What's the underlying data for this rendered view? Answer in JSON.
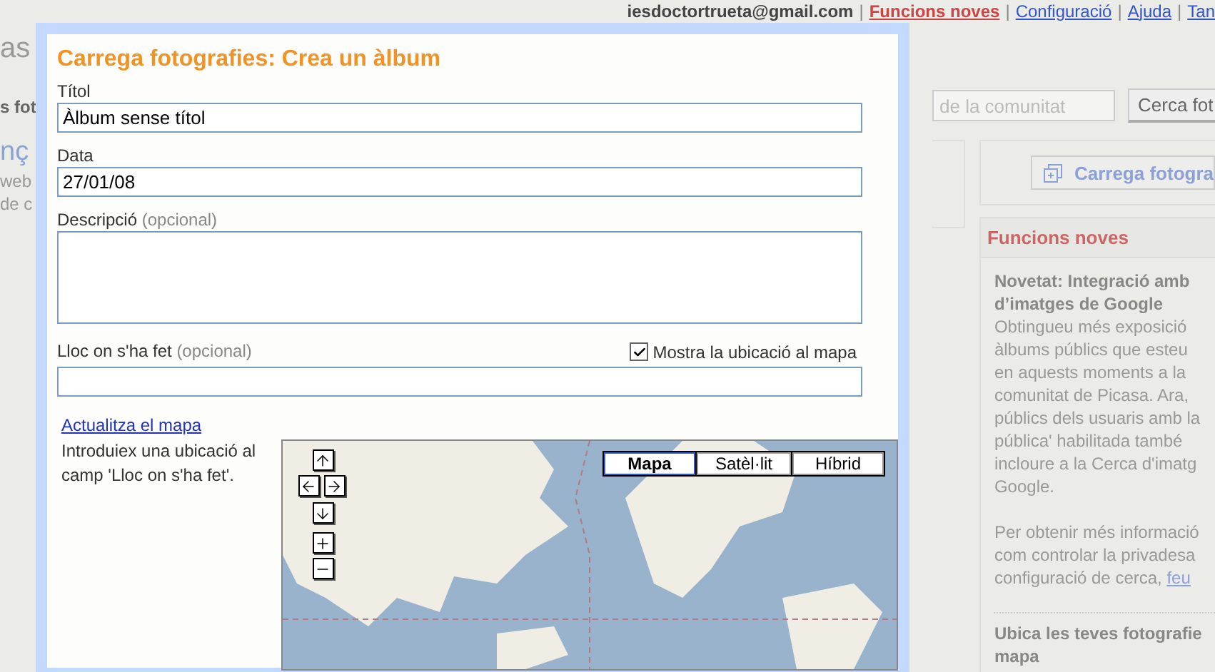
{
  "header": {
    "account": "iesdoctortrueta@gmail.com",
    "links": [
      {
        "label": "Funcions noves",
        "highlighted": true
      },
      {
        "label": "Configuració",
        "highlighted": false
      },
      {
        "label": "Ajuda",
        "highlighted": false
      },
      {
        "label": "Tan",
        "highlighted": false
      }
    ]
  },
  "header_separator": "|",
  "background_fragments": [
    {
      "kind": "logo",
      "text": "as"
    },
    {
      "kind": "tab",
      "text": "s fot"
    },
    {
      "kind": "heading",
      "text": "nç"
    },
    {
      "kind": "text",
      "text": "web"
    },
    {
      "kind": "text",
      "text": "de c"
    }
  ],
  "search": {
    "placeholder": "de la comunitat",
    "button": "Cerca fot"
  },
  "upload_button": "Carrega fotogra",
  "news": {
    "title": "Funcions noves",
    "items": [
      {
        "heading": [
          "Novetat: Integració amb",
          "d’imatges de Google"
        ],
        "paragraphs": [
          [
            "Obtingueu més exposició",
            "àlbums públics que esteu",
            "en aquests moments a la",
            "comunitat de Picasa. Ara,",
            "públics dels usuaris amb la",
            "pública' habilitada també",
            "incloure a la Cerca d'imatg",
            "Google."
          ],
          [
            "Per obtenir més informació",
            "com controlar la privadesa",
            "configuració de cerca,"
          ]
        ],
        "link": "feu"
      },
      {
        "heading": [
          "Ubica les teves fotografie",
          "mapa"
        ]
      }
    ]
  },
  "dialog": {
    "title": "Carrega fotografies: Crea un àlbum",
    "fields": [
      {
        "kind": "input",
        "label": "Títol",
        "value": "Àlbum sense títol"
      },
      {
        "kind": "input",
        "label": "Data",
        "value": "27/01/08"
      },
      {
        "kind": "textarea",
        "label": "Descripció",
        "note": "(opcional)"
      },
      {
        "kind": "input",
        "label": "Lloc on s'ha fet",
        "note": "(opcional)",
        "checkbox": {
          "label": "Mostra la ubicació al mapa",
          "checked": true
        }
      }
    ],
    "update_link": "Actualitza el mapa",
    "hint": "Introduiex una ubicació al camp 'Lloc on s'ha fet'.",
    "map_types": [
      {
        "label": "Mapa",
        "selected": true
      },
      {
        "label": "Satèl·lit",
        "selected": false
      },
      {
        "label": "Híbrid",
        "selected": false
      }
    ]
  }
}
